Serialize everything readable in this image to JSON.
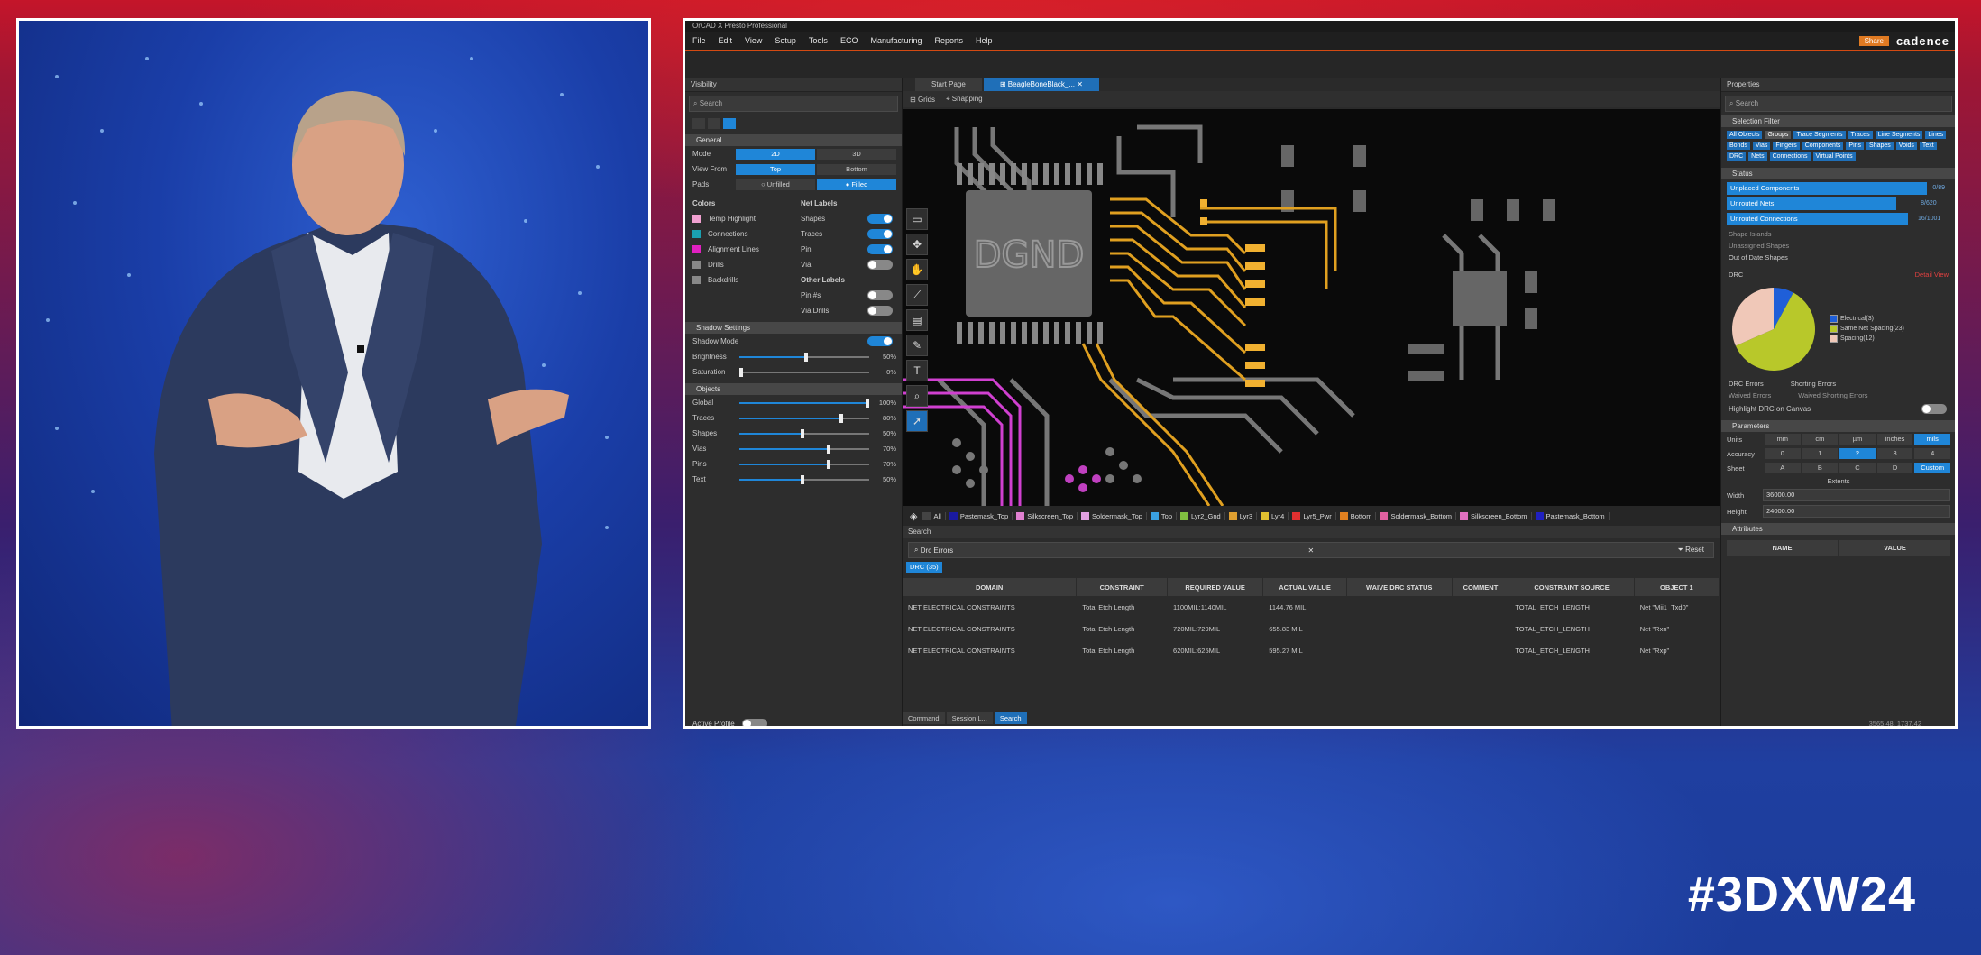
{
  "hashtag": "#3DXW24",
  "app": {
    "title": "OrCAD X Presto Professional",
    "menu": [
      "File",
      "Edit",
      "View",
      "Setup",
      "Tools",
      "ECO",
      "Manufacturing",
      "Reports",
      "Help"
    ],
    "share": "Share",
    "brand": "cadence"
  },
  "visibility": {
    "title": "Visibility",
    "search_placeholder": "Search",
    "general_section": "General",
    "mode_label": "Mode",
    "mode_options": [
      "2D",
      "3D"
    ],
    "view_from_label": "View From",
    "view_from_options": [
      "Top",
      "Bottom"
    ],
    "pads_label": "Pads",
    "pads_options": [
      "Unfilled",
      "Filled"
    ],
    "colors_title": "Colors",
    "colors": [
      {
        "label": "Temp Highlight",
        "color": "#f0a0d0"
      },
      {
        "label": "Connections",
        "color": "#1aa0b0"
      },
      {
        "label": "Alignment Lines",
        "color": "#e020c0"
      },
      {
        "label": "Drills",
        "color": "#888888"
      },
      {
        "label": "Backdrills",
        "color": "#888888"
      }
    ],
    "net_labels_title": "Net Labels",
    "net_labels": [
      {
        "label": "Shapes",
        "on": true
      },
      {
        "label": "Traces",
        "on": true
      },
      {
        "label": "Pin",
        "on": true
      },
      {
        "label": "Via",
        "on": false
      }
    ],
    "other_labels_title": "Other Labels",
    "other_labels": [
      {
        "label": "Pin #s",
        "on": false
      },
      {
        "label": "Via Drills",
        "on": false
      }
    ],
    "shadow_section": "Shadow Settings",
    "shadow_mode_label": "Shadow Mode",
    "brightness_label": "Brightness",
    "brightness_value": "50%",
    "saturation_label": "Saturation",
    "saturation_value": "0%",
    "objects_section": "Objects",
    "objects": [
      {
        "label": "Global",
        "value": "100%",
        "level": 1.0
      },
      {
        "label": "Traces",
        "value": "80%",
        "level": 0.8
      },
      {
        "label": "Shapes",
        "value": "50%",
        "level": 0.5
      },
      {
        "label": "Vias",
        "value": "70%",
        "level": 0.7
      },
      {
        "label": "Pins",
        "value": "70%",
        "level": 0.7
      },
      {
        "label": "Text",
        "value": "50%",
        "level": 0.5
      }
    ],
    "footer_label": "Active Profile"
  },
  "canvas": {
    "tabs": [
      "Start Page",
      "BeagleBoneBlack_..."
    ],
    "grids_label": "Grids",
    "snapping_label": "Snapping",
    "component_label": "DGND"
  },
  "layers": [
    {
      "label": "All",
      "color": "#444444"
    },
    {
      "label": "Pastemask_Top",
      "color": "#1a1aa0"
    },
    {
      "label": "Silkscreen_Top",
      "color": "#e080d0"
    },
    {
      "label": "Soldermask_Top",
      "color": "#e0a0e0"
    },
    {
      "label": "Top",
      "color": "#3aa0e0"
    },
    {
      "label": "Lyr2_Gnd",
      "color": "#80c040"
    },
    {
      "label": "Lyr3",
      "color": "#e0a030"
    },
    {
      "label": "Lyr4",
      "color": "#e0c030"
    },
    {
      "label": "Lyr5_Pwr",
      "color": "#e03030"
    },
    {
      "label": "Bottom",
      "color": "#e08020"
    },
    {
      "label": "Soldermask_Bottom",
      "color": "#e060a0"
    },
    {
      "label": "Silkscreen_Bottom",
      "color": "#e070c0"
    },
    {
      "label": "Pastemask_Bottom",
      "color": "#2020c0"
    }
  ],
  "search_panel": {
    "title": "Search",
    "query": "Drc Errors",
    "reset": "Reset",
    "chip": "DRC (35)",
    "columns": [
      "DOMAIN",
      "CONSTRAINT",
      "REQUIRED VALUE",
      "ACTUAL VALUE",
      "WAIVE DRC STATUS",
      "COMMENT",
      "CONSTRAINT SOURCE",
      "OBJECT 1"
    ],
    "rows": [
      [
        "NET ELECTRICAL CONSTRAINTS",
        "Total Etch Length",
        "1100MIL:1140MIL",
        "1144.76 MIL",
        "",
        "",
        "TOTAL_ETCH_LENGTH",
        "Net \"Mii1_Txd0\""
      ],
      [
        "NET ELECTRICAL CONSTRAINTS",
        "Total Etch Length",
        "720MIL:729MIL",
        "655.83 MIL",
        "",
        "",
        "TOTAL_ETCH_LENGTH",
        "Net \"Rxn\""
      ],
      [
        "NET ELECTRICAL CONSTRAINTS",
        "Total Etch Length",
        "620MIL:625MIL",
        "595.27 MIL",
        "",
        "",
        "TOTAL_ETCH_LENGTH",
        "Net \"Rxp\""
      ]
    ],
    "bottom_tabs": [
      "Command",
      "Session L...",
      "Search"
    ]
  },
  "properties": {
    "title": "Properties",
    "search_placeholder": "Search",
    "selection_filter": "Selection Filter",
    "filters": [
      "All Objects",
      "Groups",
      "Trace Segments",
      "Traces",
      "Line Segments",
      "Lines",
      "Bonds",
      "Vias",
      "Fingers",
      "Components",
      "Pins",
      "Shapes",
      "Voids",
      "Text",
      "DRC",
      "Nets",
      "Connections",
      "Virtual Points"
    ],
    "status_section": "Status",
    "status_bars": [
      {
        "label": "Unplaced Components",
        "value": "0/89",
        "fill": 1.0
      },
      {
        "label": "Unrouted Nets",
        "value": "8/620",
        "fill": 0.87
      },
      {
        "label": "Unrouted Connections",
        "value": "16/1001",
        "fill": 0.92
      }
    ],
    "status_lines": [
      "Shape Islands",
      "Unassigned Shapes",
      "Out of Date Shapes"
    ],
    "drc_label": "DRC",
    "drc_link": "Detail View",
    "pie": [
      {
        "name": "Electrical(3)",
        "value": 3,
        "color": "#1f5fd8"
      },
      {
        "name": "Same Net Spacing(23)",
        "value": 23,
        "color": "#b8c82a"
      },
      {
        "name": "Spacing(12)",
        "value": 12,
        "color": "#f0c8b8"
      }
    ],
    "drc_errors": "DRC Errors",
    "shorting_errors": "Shorting Errors",
    "waived_errors": "Waived Errors",
    "waived_shorting": "Waived Shorting Errors",
    "highlight_label": "Highlight DRC on Canvas",
    "parameters_section": "Parameters",
    "units_label": "Units",
    "units": [
      "mm",
      "cm",
      "µm",
      "inches",
      "mils"
    ],
    "accuracy_label": "Accuracy",
    "accuracy": [
      "0",
      "1",
      "2",
      "3",
      "4"
    ],
    "sheet_label": "Sheet",
    "sheets": [
      "A",
      "B",
      "C",
      "D",
      "Custom"
    ],
    "extents_label": "Extents",
    "width_label": "Width",
    "width_value": "36000.00",
    "height_label": "Height",
    "height_value": "24000.00",
    "attributes_section": "Attributes",
    "attr_cols": [
      "NAME",
      "VALUE"
    ],
    "coords": "3565.48, 1737.42"
  }
}
